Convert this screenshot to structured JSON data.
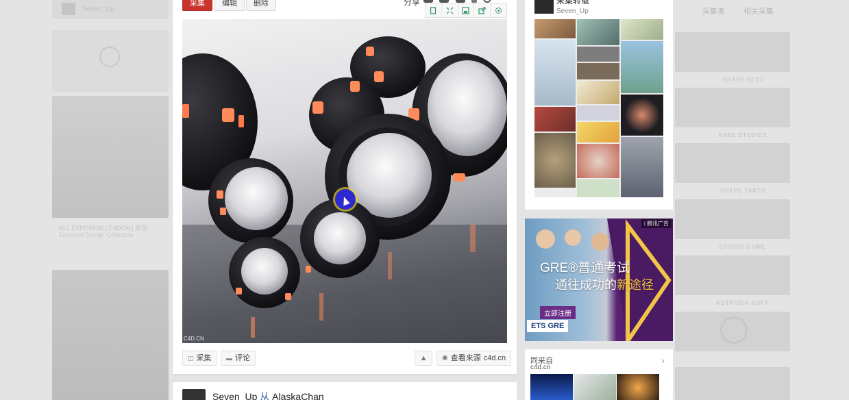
{
  "background": {
    "left_username": "Seven_Up",
    "left_caption": "ALL EXPOSION | C4DCN | 发现",
    "left_caption2": "Featured Design Collection",
    "right_tab_1": "采集者",
    "right_tab_2": "相关采集",
    "right_labels": [
      "SHAPE SETS",
      "BASE STUDIES",
      "SHAPE PARTS",
      "STUDIO 3 ONE",
      "ROTATION SOFT"
    ]
  },
  "main_card": {
    "collect_label": "采集",
    "edit_label": "编辑",
    "delete_label": "删除",
    "share_label": "分享",
    "watermark": "C4D.CN",
    "bottom": {
      "collect_label": "采集",
      "comment_label": "评论",
      "view_source_label": "查看来源",
      "source_domain": "c4d.cn"
    }
  },
  "next_pin": {
    "user": "Seven_Up",
    "from_word": "从",
    "source_user": "AlaskaChan"
  },
  "board": {
    "title": "采集转载",
    "user": "Seven_Up"
  },
  "ad": {
    "badge": "i 腾讯广告",
    "headline": "GRE®普通考试",
    "sub_prefix": "通往成功的",
    "sub_highlight": "新途径",
    "cta": "立即注册",
    "logo": "ETS GRE"
  },
  "same_source": {
    "title": "同采自",
    "domain": "c4d.cn",
    "arrow": "›"
  },
  "colors": {
    "collect_red": "#c9342c",
    "ad_purple": "#5a2272",
    "cursor_blue": "#2d2ad1"
  }
}
